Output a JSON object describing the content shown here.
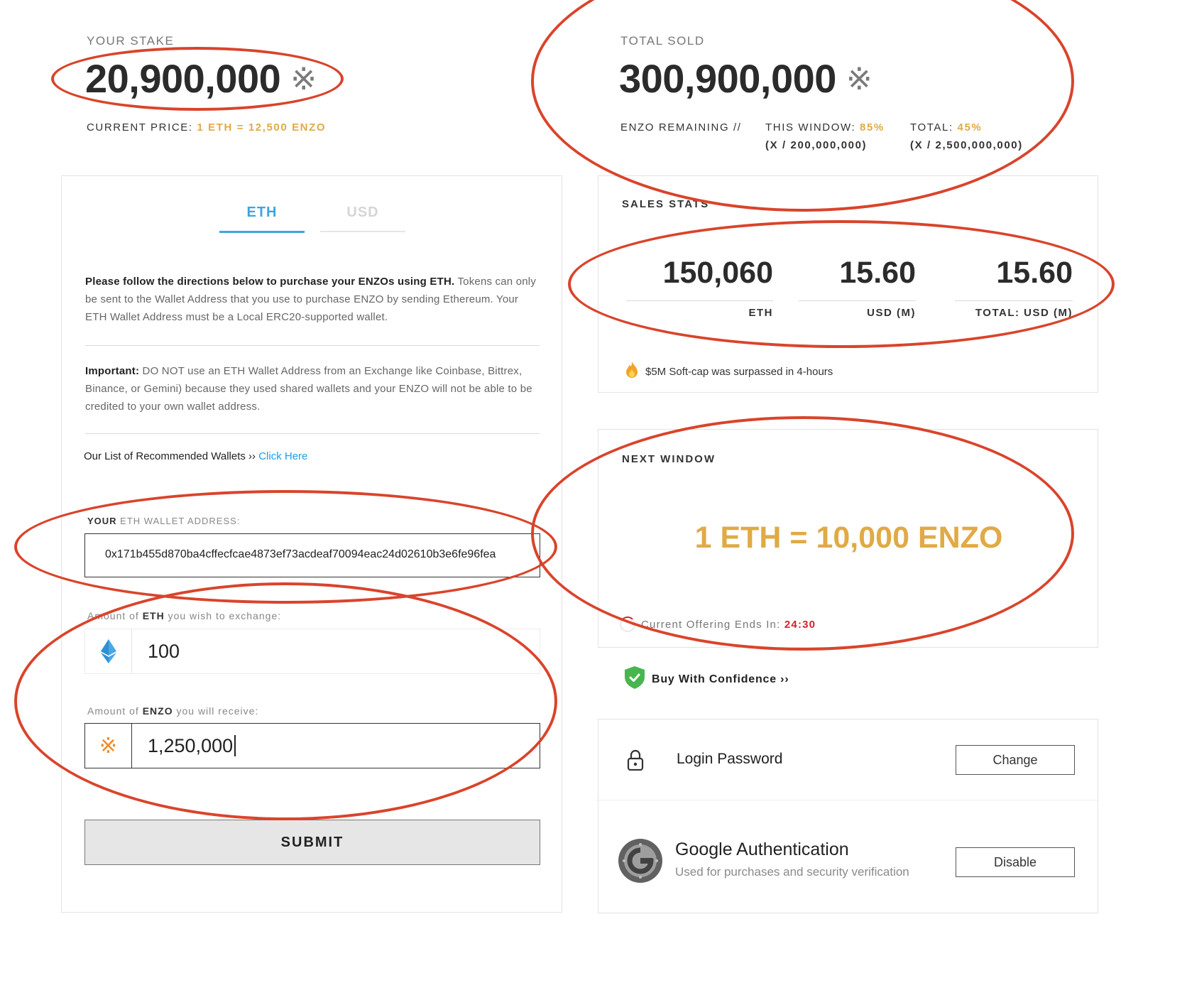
{
  "stake": {
    "label": "YOUR STAKE",
    "value": "20,900,000",
    "price_label": "CURRENT PRICE:",
    "price_value": "1 ETH = 12,500 ENZO"
  },
  "total_sold": {
    "label": "TOTAL SOLD",
    "value": "300,900,000",
    "remaining_label": "ENZO REMAINING //",
    "window_label": "THIS WINDOW:",
    "window_pct": "85%",
    "window_sub": "(X / 200,000,000)",
    "total_label": "TOTAL:",
    "total_pct": "45%",
    "total_sub": "(X / 2,500,000,000)"
  },
  "tabs": [
    {
      "label": "ETH",
      "active": true
    },
    {
      "label": "USD",
      "active": false
    }
  ],
  "instructions": {
    "bold": "Please follow the directions below to purchase your ENZOs using ETH.",
    "rest": " Tokens can only be sent to the Wallet Address that you use to purchase ENZO by sending Ethereum. Your ETH Wallet Address must be a Local ERC20-supported wallet.",
    "important_label": "Important:",
    "important_text": " DO NOT use an ETH Wallet Address from an Exchange like Coinbase, Bittrex, Binance, or Gemini) because they used shared wallets and your ENZO will not be able to be credited to your own wallet address.",
    "wallets_text": "Our List of Recommended Wallets ›› ",
    "wallets_link": "Click Here"
  },
  "form": {
    "wallet_label_bold": "YOUR",
    "wallet_label_rest": " ETH WALLET ADDRESS:",
    "wallet_value": "0x171b455d870ba4cffecfcae4873ef73acdeaf70094eac24d02610b3e6fe96fea",
    "eth_label_pre": "Amount of ",
    "eth_label_bold": "ETH",
    "eth_label_post": " you wish to exchange:",
    "eth_value": "100",
    "enzo_label_pre": "Amount of ",
    "enzo_label_bold": "ENZO",
    "enzo_label_post": " you will receive:",
    "enzo_value": "1,250,000",
    "submit_label": "SUBMIT"
  },
  "sales_stats": {
    "title": "SALES STATS",
    "items": [
      {
        "value": "150,060",
        "unit": "ETH"
      },
      {
        "value": "15.60",
        "unit": "USD (M)"
      },
      {
        "value": "15.60",
        "unit": "TOTAL: USD (M)"
      }
    ],
    "note": "$5M Soft-cap was surpassed in 4-hours"
  },
  "next_window": {
    "title": "NEXT WINDOW",
    "rate": "1 ETH = 10,000 ENZO",
    "ends_label": "Current Offering Ends In:",
    "ends_value": "24:30"
  },
  "confidence": {
    "label": "Buy With Confidence ››"
  },
  "security": {
    "login_label": "Login Password",
    "login_button": "Change",
    "google_title": "Google Authentication",
    "google_sub": "Used for purchases and security verification",
    "google_button": "Disable"
  },
  "colors": {
    "accent_gold": "#e0aa45",
    "accent_blue": "#3aa6e0",
    "alert_red": "#d2232a",
    "annotation_red": "#d9442b"
  }
}
